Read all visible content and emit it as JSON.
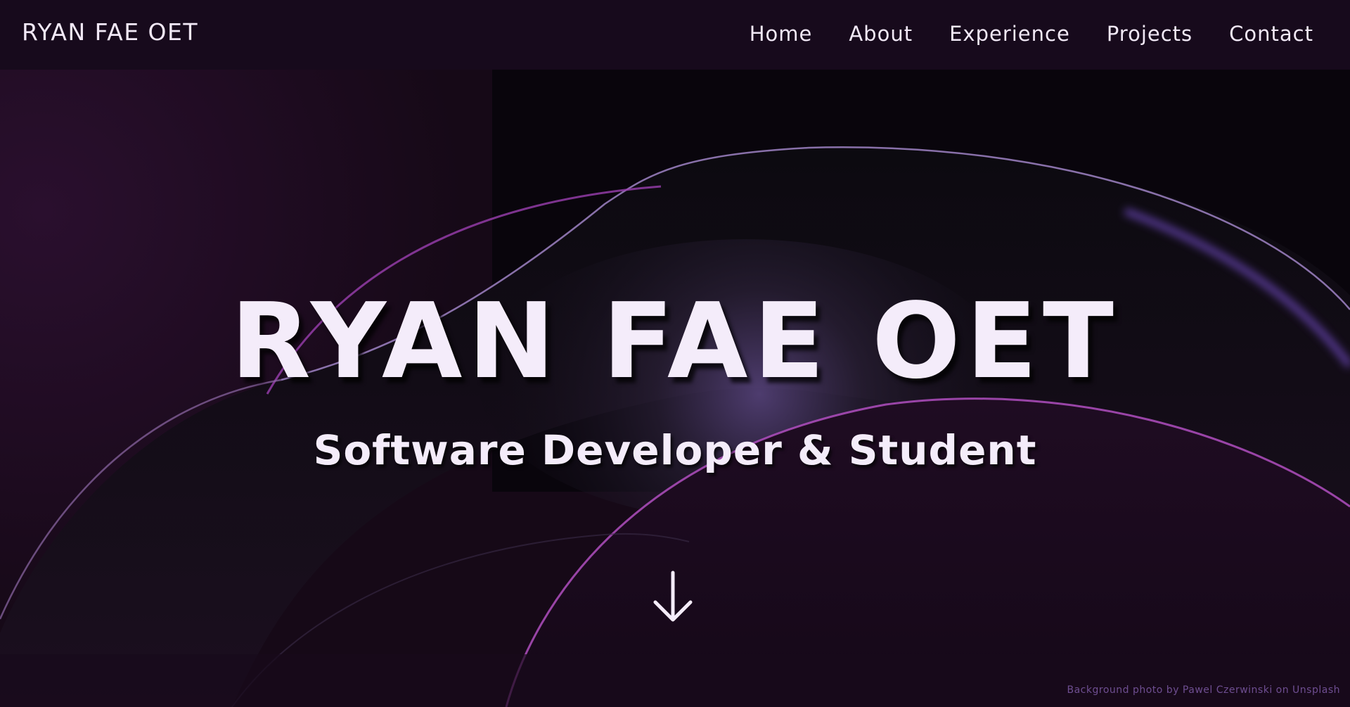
{
  "navbar": {
    "brand": "RYAN FAE OET",
    "links": [
      "Home",
      "About",
      "Experience",
      "Projects",
      "Contact"
    ]
  },
  "hero": {
    "title": "RYAN FAE OET",
    "subtitle": "Software Developer & Student",
    "scroll_icon": "arrow-down-icon"
  },
  "footer": {
    "credit": "Background photo by Pawel Czerwinski on Unsplash"
  },
  "colors": {
    "background": "#14081a",
    "navbar": "#170a1c",
    "text": "#f4ecfa",
    "accent": "#8a4bd6",
    "credit": "#6e4e91"
  }
}
